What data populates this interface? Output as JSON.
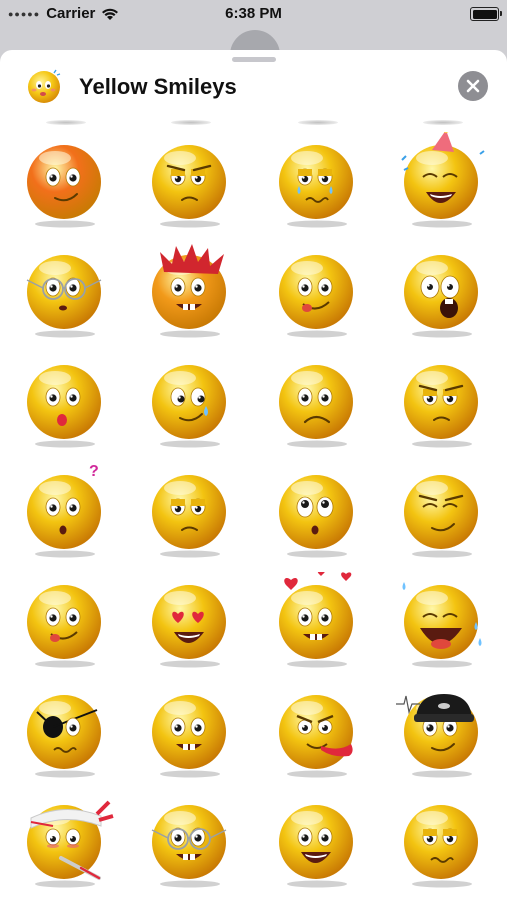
{
  "status_bar": {
    "carrier": "Carrier",
    "time": "6:38 PM"
  },
  "header": {
    "title": "Yellow Smileys",
    "app_icon": "smiley-app-icon",
    "close_icon": "close-icon"
  },
  "stickers": [
    {
      "name": "orange-smiley-sticker",
      "color": "#f2701b",
      "eyes": "normal",
      "mouth": "smirk",
      "extra": "none"
    },
    {
      "name": "grumpy-smiley-sticker",
      "color": "#f3c411",
      "eyes": "lidded",
      "mouth": "frown-small",
      "extra": "brows-angry"
    },
    {
      "name": "teary-smiley-sticker",
      "color": "#f3c411",
      "eyes": "lidded",
      "mouth": "wavy",
      "extra": "tears"
    },
    {
      "name": "party-hat-smiley-sticker",
      "color": "#f3c411",
      "eyes": "closed",
      "mouth": "grin",
      "extra": "party-hat"
    },
    {
      "name": "glasses-smiley-sticker",
      "color": "#f3c411",
      "eyes": "normal",
      "mouth": "small",
      "extra": "glasses"
    },
    {
      "name": "spiky-hair-smiley-sticker",
      "color": "#f29a1a",
      "eyes": "normal",
      "mouth": "teeth",
      "extra": "spiky-hair"
    },
    {
      "name": "tongue-smiley-sticker",
      "color": "#f3c411",
      "eyes": "normal",
      "mouth": "tongue-side",
      "extra": "none"
    },
    {
      "name": "scared-smiley-sticker",
      "color": "#f3c411",
      "eyes": "wide",
      "mouth": "open-scared",
      "extra": "none"
    },
    {
      "name": "kiss-smiley-sticker",
      "color": "#f3c411",
      "eyes": "normal",
      "mouth": "kiss",
      "extra": "none"
    },
    {
      "name": "side-look-smiley-sticker",
      "color": "#f3c411",
      "eyes": "side",
      "mouth": "smirk",
      "extra": "tear-drop"
    },
    {
      "name": "sad-smiley-sticker",
      "color": "#f3c411",
      "eyes": "normal",
      "mouth": "frown",
      "extra": "none"
    },
    {
      "name": "annoyed-smiley-sticker",
      "color": "#f3c411",
      "eyes": "lidded",
      "mouth": "frown-small",
      "extra": "brows-angry"
    },
    {
      "name": "confused-smiley-sticker",
      "color": "#f3c411",
      "eyes": "normal",
      "mouth": "o-small",
      "extra": "question-mark"
    },
    {
      "name": "worried-smiley-sticker",
      "color": "#f3c411",
      "eyes": "lidded",
      "mouth": "frown-small",
      "extra": "none"
    },
    {
      "name": "surprised-smiley-sticker",
      "color": "#f3c411",
      "eyes": "up",
      "mouth": "o-small",
      "extra": "none"
    },
    {
      "name": "devious-smiley-sticker",
      "color": "#f3c411",
      "eyes": "closed",
      "mouth": "smirk",
      "extra": "brows-angry"
    },
    {
      "name": "yum-smiley-sticker",
      "color": "#f3c411",
      "eyes": "normal",
      "mouth": "tongue-side",
      "extra": "none"
    },
    {
      "name": "heart-eyes-smiley-sticker",
      "color": "#f3c411",
      "eyes": "hearts",
      "mouth": "grin",
      "extra": "none"
    },
    {
      "name": "love-smiley-sticker",
      "color": "#f3c411",
      "eyes": "normal",
      "mouth": "teeth",
      "extra": "hearts-above"
    },
    {
      "name": "laughing-smiley-sticker",
      "color": "#f3c411",
      "eyes": "closed",
      "mouth": "laugh",
      "extra": "sweat-drops"
    },
    {
      "name": "pirate-smiley-sticker",
      "color": "#f3c411",
      "eyes": "patch",
      "mouth": "wavy",
      "extra": "none"
    },
    {
      "name": "toothy-smiley-sticker",
      "color": "#f3c411",
      "eyes": "normal",
      "mouth": "teeth",
      "extra": "none"
    },
    {
      "name": "raspberry-smiley-sticker",
      "color": "#f3c411",
      "eyes": "angry",
      "mouth": "tongue-long",
      "extra": "none"
    },
    {
      "name": "cap-smiley-sticker",
      "color": "#f3c411",
      "eyes": "normal",
      "mouth": "smirk",
      "extra": "cap"
    },
    {
      "name": "sick-smiley-sticker",
      "color": "#f3c411",
      "eyes": "sick",
      "mouth": "thermometer",
      "extra": "bandage"
    },
    {
      "name": "nerd-smiley-sticker",
      "color": "#f3c411",
      "eyes": "normal",
      "mouth": "teeth",
      "extra": "glasses"
    },
    {
      "name": "happy-smiley-sticker",
      "color": "#f3c411",
      "eyes": "normal",
      "mouth": "grin",
      "extra": "none"
    },
    {
      "name": "pleading-smiley-sticker",
      "color": "#f3c411",
      "eyes": "lidded",
      "mouth": "wavy",
      "extra": "none"
    }
  ]
}
